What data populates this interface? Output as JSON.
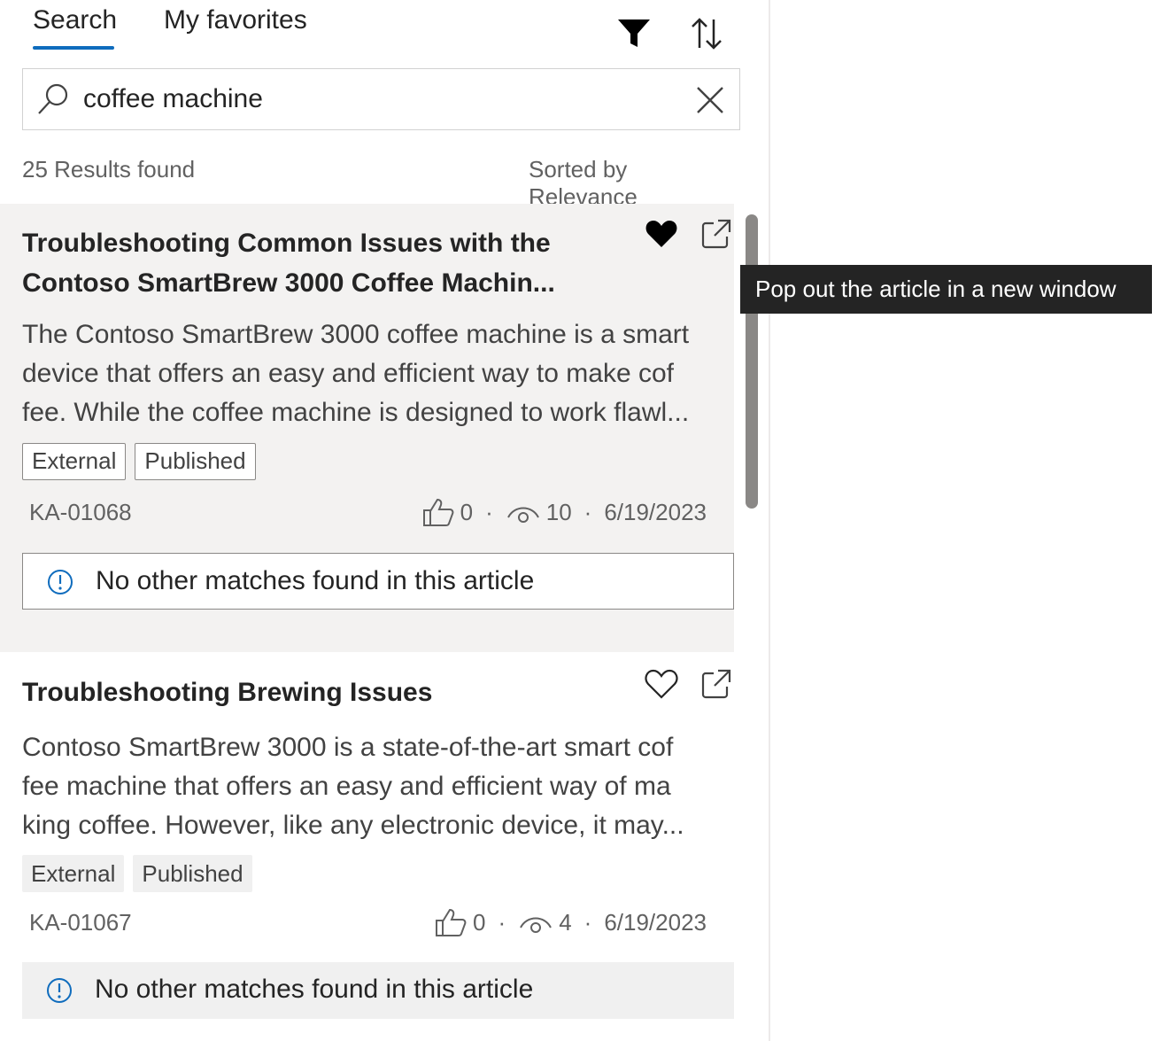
{
  "tabs": [
    {
      "label": "Search",
      "active": true
    },
    {
      "label": "My favorites",
      "active": false
    }
  ],
  "toolbar": {
    "filter_icon": "filter-icon",
    "sort_icon": "sort-icon"
  },
  "search": {
    "value": "coffee machine",
    "placeholder": ""
  },
  "results": {
    "count_text": "25 Results found",
    "sorted_text": "Sorted by Relevance"
  },
  "articles": [
    {
      "title_line1": "Troubleshooting Common Issues with the",
      "title_line2": "Contoso SmartBrew 3000 Coffee Machin...",
      "body_line1": "The Contoso SmartBrew 3000 coffee machine is a smart",
      "body_line2": "device that offers an easy and efficient way to make cof",
      "body_line3": "fee. While the coffee machine is designed to work flawl...",
      "tags": [
        "External",
        "Published"
      ],
      "id": "KA-01068",
      "likes": "0",
      "views": "10",
      "date": "6/19/2023",
      "favorited": true,
      "match_message": "No other matches found in this article"
    },
    {
      "title_line1": "Troubleshooting Brewing Issues",
      "body_line1": "Contoso SmartBrew 3000 is a state-of-the-art smart cof",
      "body_line2": "fee machine that offers an easy and efficient way of ma",
      "body_line3": "king coffee. However, like any electronic device, it may...",
      "tags": [
        "External",
        "Published"
      ],
      "id": "KA-01067",
      "likes": "0",
      "views": "4",
      "date": "6/19/2023",
      "favorited": false,
      "match_message": "No other matches found in this article"
    }
  ],
  "tooltip": {
    "text": "Pop out the article in a new window"
  },
  "colors": {
    "accent": "#0f6cbd",
    "info_icon": "#0f6cbd",
    "tooltip_bg": "#242424",
    "selected_card_bg": "#f3f2f1"
  }
}
